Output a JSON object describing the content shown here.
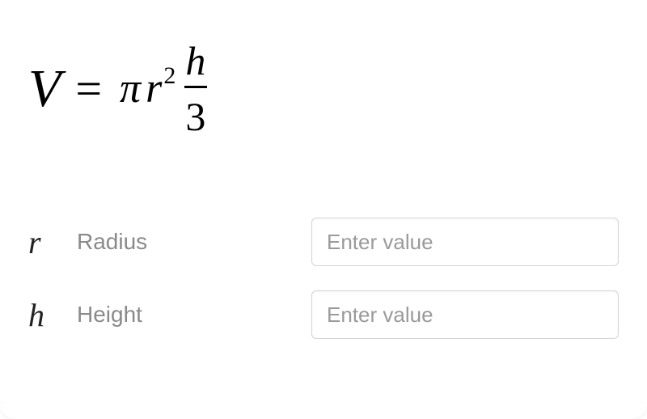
{
  "formula": {
    "V": "V",
    "equals": "=",
    "pi": "π",
    "r": "r",
    "exponent": "2",
    "frac_num": "h",
    "frac_den": "3"
  },
  "inputs": {
    "radius": {
      "symbol": "r",
      "label": "Radius",
      "placeholder": "Enter value",
      "value": ""
    },
    "height": {
      "symbol": "h",
      "label": "Height",
      "placeholder": "Enter value",
      "value": ""
    }
  }
}
